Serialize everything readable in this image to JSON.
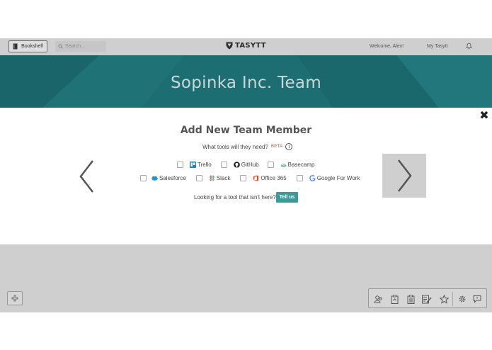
{
  "header": {
    "bookshelf_label": "Bookshelf",
    "search_placeholder": "Search...",
    "logo_text": "TASYTT",
    "welcome": "Welcome, Alex!",
    "my_tasytt": "My Tasytt"
  },
  "banner": {
    "title": "Sopinka Inc. Team"
  },
  "modal": {
    "title": "Add New Team Member",
    "question": "What tools will they need?",
    "beta": "BETA",
    "info_symbol": "i",
    "close_symbol": "✖",
    "tools_row1": [
      {
        "name": "Trello",
        "checked": false,
        "icon": "trello-icon"
      },
      {
        "name": "GitHub",
        "checked": false,
        "icon": "github-icon"
      },
      {
        "name": "Basecamp",
        "checked": false,
        "icon": "basecamp-icon"
      }
    ],
    "tools_row2": [
      {
        "name": "Salesforce",
        "checked": false,
        "icon": "salesforce-icon"
      },
      {
        "name": "Slack",
        "checked": false,
        "icon": "slack-icon"
      },
      {
        "name": "Office 365",
        "checked": false,
        "icon": "office-icon"
      },
      {
        "name": "Google For Work",
        "checked": false,
        "icon": "google-icon"
      }
    ],
    "looking_text": "Looking for a tool that isn't here?",
    "tell_us": "Tell us"
  },
  "colors": {
    "banner": "#1d6e72",
    "accent_button": "#3a9b9b",
    "beta": "#dd3333",
    "overlay_gray": "#cfcfcf"
  },
  "toolbar_icons": [
    "users-icon",
    "clipboard-up-icon",
    "clipboard-list-icon",
    "edit-list-icon",
    "star-icon",
    "gear-icon",
    "chat-icon"
  ]
}
